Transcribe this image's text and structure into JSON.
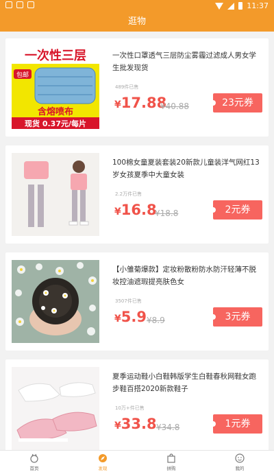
{
  "status_bar": {
    "time": "11:37"
  },
  "header": {
    "title": "逛物"
  },
  "products": [
    {
      "title": "一次性口罩透气三层防尘雾霾过滤成人男女学生批发现货",
      "sold": "489件已售",
      "currency": "¥",
      "price": "17.88",
      "orig_price": "¥40.88",
      "coupon": "23元券",
      "image_text": {
        "banner": "一次性三层",
        "tag": "包邮",
        "sub": "含熔喷布",
        "bottom": "现货  0.37元/每片"
      }
    },
    {
      "title": "100棉女童夏装套装20新款儿童装洋气网红13岁女孩夏季中大童女装",
      "sold": "2.2万件已售",
      "currency": "¥",
      "price": "16.8",
      "orig_price": "¥18.8",
      "coupon": "2元券"
    },
    {
      "title": "【小雏菊爆款】定妆粉散粉防水防汗轻薄不脱妆控油遮瑕提亮肤色女",
      "sold": "3507件已售",
      "currency": "¥",
      "price": "5.9",
      "orig_price": "¥8.9",
      "coupon": "3元券"
    },
    {
      "title": "夏季运动鞋小白鞋韩版学生白鞋春秋网鞋女跑步鞋百搭2020新款鞋子",
      "sold": "10万+件已售",
      "currency": "¥",
      "price": "33.8",
      "orig_price": "¥34.8",
      "coupon": "1元券"
    }
  ],
  "tabs": [
    {
      "label": "首页",
      "icon": "home-icon"
    },
    {
      "label": "发现",
      "icon": "discover-icon"
    },
    {
      "label": "拼购",
      "icon": "bag-icon"
    },
    {
      "label": "我的",
      "icon": "profile-icon"
    }
  ],
  "colors": {
    "accent": "#f39a2a",
    "price": "#f0534a",
    "coupon": "#f7655f"
  }
}
